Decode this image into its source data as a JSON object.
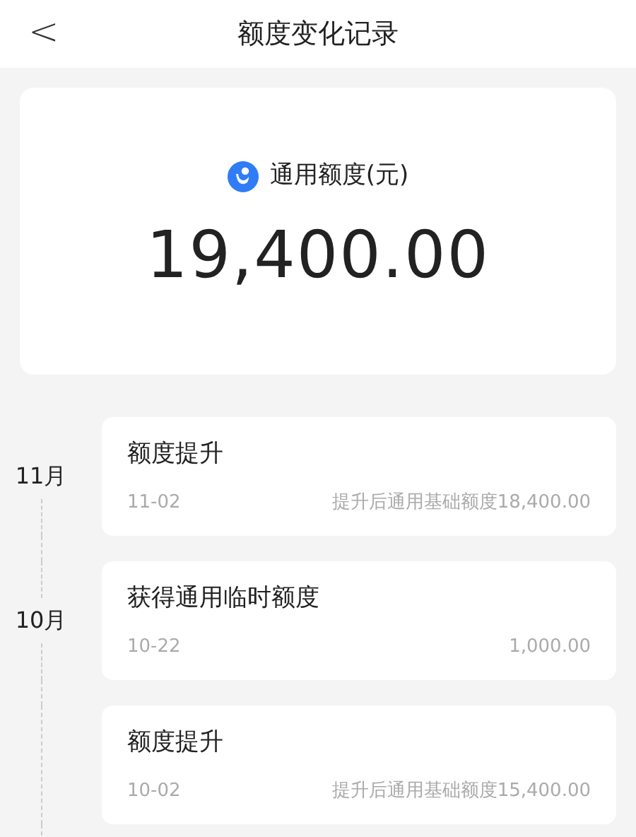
{
  "header": {
    "back": "<",
    "title": "额度变化记录"
  },
  "summary": {
    "label": "通用额度(元)",
    "amount": "19,400.00"
  },
  "months": [
    {
      "label": "11月",
      "records": [
        {
          "title": "额度提升",
          "date": "11-02",
          "detail": "提升后通用基础额度18,400.00"
        }
      ]
    },
    {
      "label": "10月",
      "records": [
        {
          "title": "获得通用临时额度",
          "date": "10-22",
          "detail": "1,000.00"
        },
        {
          "title": "额度提升",
          "date": "10-02",
          "detail": "提升后通用基础额度15,400.00"
        }
      ]
    }
  ]
}
